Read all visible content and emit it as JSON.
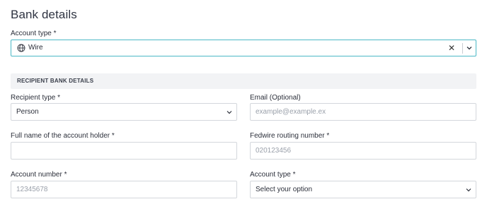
{
  "page_title": "Bank details",
  "account_type_top": {
    "label": "Account type *",
    "value": "Wire",
    "icon": "globe-icon",
    "clear_glyph": "✕"
  },
  "section": {
    "title": "RECIPIENT BANK DETAILS"
  },
  "recipient_type": {
    "label": "Recipient type *",
    "value": "Person"
  },
  "email": {
    "label": "Email (Optional)",
    "placeholder": "example@example.ex"
  },
  "full_name": {
    "label": "Full name of the account holder *",
    "value": ""
  },
  "fedwire": {
    "label": "Fedwire routing number *",
    "placeholder": "020123456"
  },
  "account_number": {
    "label": "Account number *",
    "placeholder": "12345678"
  },
  "account_type_bottom": {
    "label": "Account type *",
    "value": "Select your option"
  },
  "colors": {
    "focus_border": "#4bb8c6",
    "field_border": "#d4d7dc",
    "section_bg": "#f2f3f5",
    "placeholder": "#9aa0aa"
  }
}
